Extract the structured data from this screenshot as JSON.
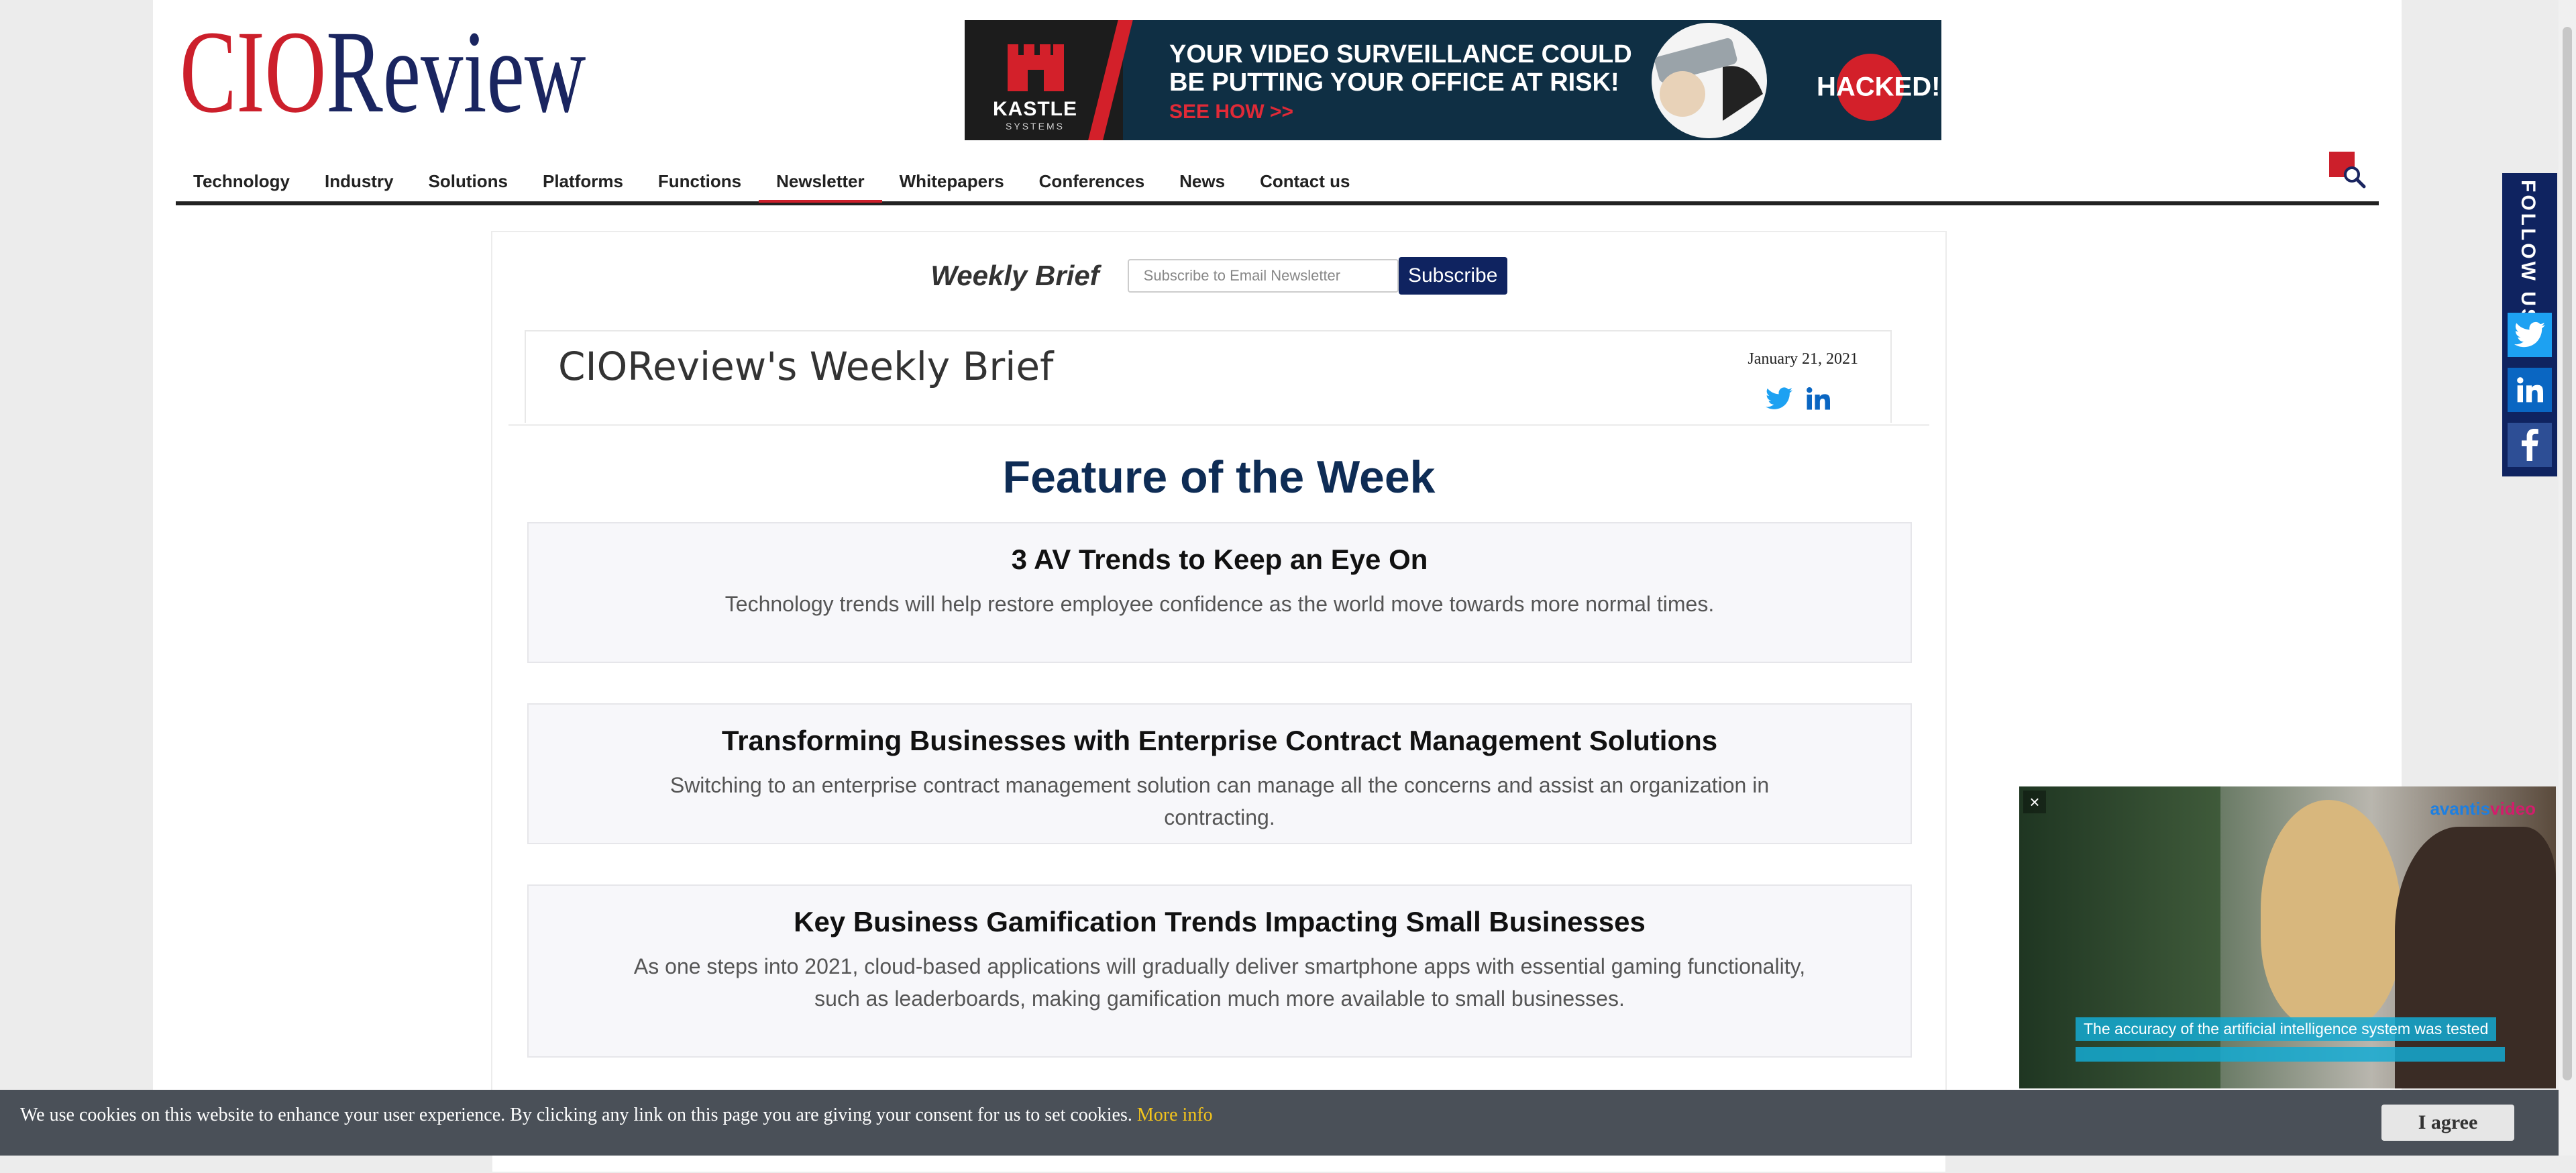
{
  "header": {
    "logo": {
      "part1": "CIO",
      "part2": "Review"
    },
    "ad": {
      "brand": "KASTLE",
      "brand_sub": "SYSTEMS",
      "headline": "YOUR VIDEO SURVEILLANCE COULD BE PUTTING YOUR OFFICE AT RISK!",
      "cta": "SEE HOW >>",
      "badge": "HACKED!"
    }
  },
  "nav": {
    "items": [
      "Technology",
      "Industry",
      "Solutions",
      "Platforms",
      "Functions",
      "Newsletter",
      "Whitepapers",
      "Conferences",
      "News",
      "Contact us"
    ],
    "active": "Newsletter"
  },
  "newsletter": {
    "label": "Weekly Brief",
    "placeholder": "Subscribe to Email Newsletter",
    "subscribe_label": "Subscribe"
  },
  "weekly": {
    "title": "CIOReview's Weekly Brief",
    "date": "January 21, 2021"
  },
  "feature": {
    "title": "Feature of the Week",
    "cards": [
      {
        "title": "3 AV Trends to Keep an Eye On",
        "desc": "Technology trends will help restore employee confidence as the world move towards more normal times."
      },
      {
        "title": "Transforming Businesses with Enterprise Contract Management Solutions",
        "desc": "Switching to an enterprise contract management solution can manage all the concerns and assist an organization in contracting."
      },
      {
        "title": "Key Business Gamification Trends Impacting Small Businesses",
        "desc": "As one steps into 2021, cloud-based applications will gradually deliver smartphone apps with essential gaming functionality, such as leaderboards, making gamification much more available to small businesses."
      }
    ]
  },
  "follow": {
    "label": "FOLLOW US"
  },
  "video": {
    "brand_a": "avantis",
    "brand_b": "video",
    "caption": "The accuracy of the artificial intelligence system was tested",
    "close": "×"
  },
  "cookie": {
    "message": "We use cookies on this website to enhance your user experience. By clicking any link on this page you are giving your consent for us to set cookies.",
    "more_info": "More info",
    "agree": "I agree"
  },
  "colors": {
    "brand_red": "#cc1f2b",
    "brand_navy": "#0f2360",
    "feature_title": "#0e2c55",
    "twitter": "#1da1f2",
    "linkedin": "#0a66c2"
  }
}
